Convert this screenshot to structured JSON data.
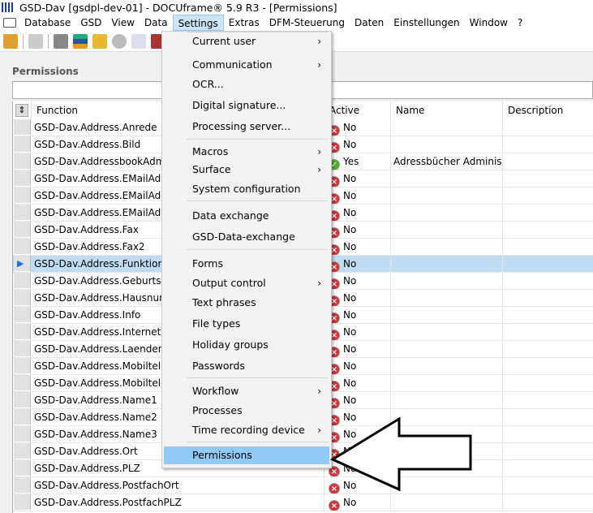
{
  "window": {
    "title": "GSD-Dav [gsdpl-dev-01] - DOCUframe® 5.9 R3 - [Permissions]"
  },
  "menubar": [
    "Database",
    "GSD",
    "View",
    "Data",
    "Settings",
    "Extras",
    "DFM-Steuerung",
    "Daten",
    "Einstellungen",
    "Window",
    "?"
  ],
  "active_menu": "Settings",
  "panel": {
    "title": "Permissions",
    "filter_value": ""
  },
  "columns": [
    "Function",
    "Active",
    "Name",
    "Description"
  ],
  "rows": [
    {
      "function": "GSD-Dav.Address.Anrede",
      "active": "No",
      "name": "",
      "description": ""
    },
    {
      "function": "GSD-Dav.Address.Bild",
      "active": "No",
      "name": "",
      "description": ""
    },
    {
      "function": "GSD-Dav.AddressbookAdmin",
      "active": "Yes",
      "name": "Adressbücher Administra",
      "description": ""
    },
    {
      "function": "GSD-Dav.Address.EMailAdress",
      "active": "No",
      "name": "",
      "description": ""
    },
    {
      "function": "GSD-Dav.Address.EMailAdress",
      "active": "No",
      "name": "",
      "description": ""
    },
    {
      "function": "GSD-Dav.Address.EMailAdress",
      "active": "No",
      "name": "",
      "description": ""
    },
    {
      "function": "GSD-Dav.Address.Fax",
      "active": "No",
      "name": "",
      "description": ""
    },
    {
      "function": "GSD-Dav.Address.Fax2",
      "active": "No",
      "name": "",
      "description": ""
    },
    {
      "function": "GSD-Dav.Address.Funktion",
      "active": "No",
      "name": "",
      "description": "",
      "selected": true
    },
    {
      "function": "GSD-Dav.Address.Geburtsdatu",
      "active": "No",
      "name": "",
      "description": ""
    },
    {
      "function": "GSD-Dav.Address.Hausnumm",
      "active": "No",
      "name": "",
      "description": ""
    },
    {
      "function": "GSD-Dav.Address.Info",
      "active": "No",
      "name": "",
      "description": ""
    },
    {
      "function": "GSD-Dav.Address.Internet",
      "active": "No",
      "name": "",
      "description": ""
    },
    {
      "function": "GSD-Dav.Address.Laenderkenn",
      "active": "No",
      "name": "",
      "description": ""
    },
    {
      "function": "GSD-Dav.Address.Mobiltelefor",
      "active": "No",
      "name": "",
      "description": ""
    },
    {
      "function": "GSD-Dav.Address.Mobiltelefor",
      "active": "No",
      "name": "",
      "description": ""
    },
    {
      "function": "GSD-Dav.Address.Name1",
      "active": "No",
      "name": "",
      "description": ""
    },
    {
      "function": "GSD-Dav.Address.Name2",
      "active": "No",
      "name": "",
      "description": ""
    },
    {
      "function": "GSD-Dav.Address.Name3",
      "active": "No",
      "name": "",
      "description": ""
    },
    {
      "function": "GSD-Dav.Address.Ort",
      "active": "No",
      "name": "",
      "description": ""
    },
    {
      "function": "GSD-Dav.Address.PLZ",
      "active": "No",
      "name": "",
      "description": ""
    },
    {
      "function": "GSD-Dav.Address.PostfachOrt",
      "active": "No",
      "name": "",
      "description": ""
    },
    {
      "function": "GSD-Dav.Address.PostfachPLZ",
      "active": "No",
      "name": "",
      "description": ""
    }
  ],
  "settings_menu": [
    {
      "label": "Current user",
      "submenu": true
    },
    {
      "sep": true
    },
    {
      "label": "Communication",
      "submenu": true
    },
    {
      "label": "OCR..."
    },
    {
      "label": "Digital signature..."
    },
    {
      "label": "Processing server..."
    },
    {
      "sep": true
    },
    {
      "label": "Macros",
      "submenu": true
    },
    {
      "label": "Surface",
      "submenu": true
    },
    {
      "label": "System configuration"
    },
    {
      "sep": true
    },
    {
      "label": "Data exchange"
    },
    {
      "label": "GSD-Data-exchange"
    },
    {
      "sep": true
    },
    {
      "label": "Forms"
    },
    {
      "label": "Output control",
      "submenu": true
    },
    {
      "label": "Text phrases"
    },
    {
      "label": "File types"
    },
    {
      "label": "Holiday groups"
    },
    {
      "label": "Passwords"
    },
    {
      "sep": true
    },
    {
      "label": "Workflow",
      "submenu": true
    },
    {
      "label": "Processes"
    },
    {
      "label": "Time recording device",
      "submenu": true
    },
    {
      "sep": true
    },
    {
      "label": "Permissions",
      "highlighted": true
    }
  ],
  "colors": {
    "highlight": "#91c9f7",
    "selected_row": "#c0dcf3",
    "no_icon": "#d0343a",
    "yes_icon": "#4caf2a"
  }
}
